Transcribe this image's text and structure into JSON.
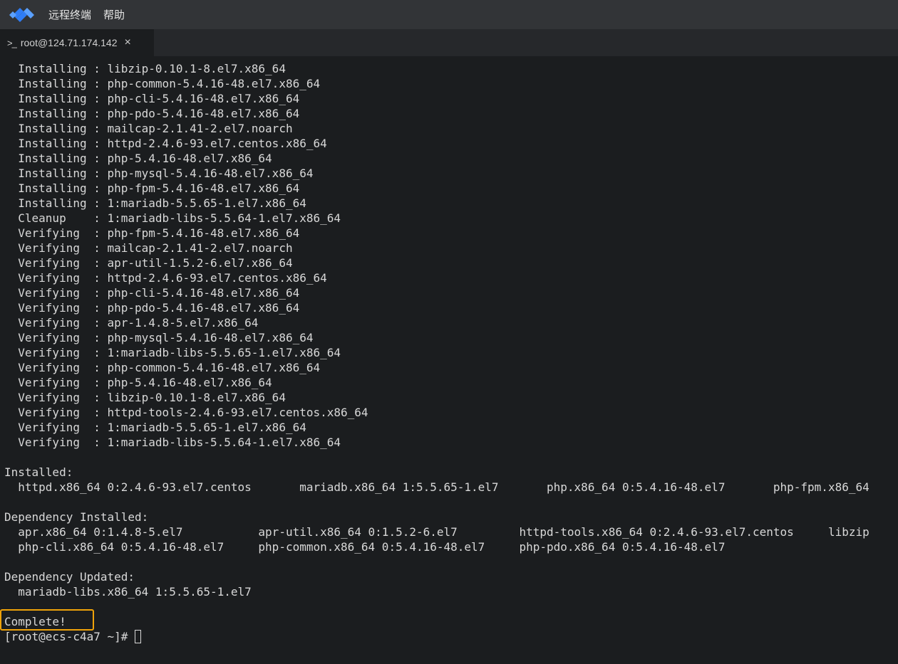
{
  "app": {
    "menu": [
      "远程终端",
      "帮助"
    ],
    "brand_color": "#2f7df6"
  },
  "tab": {
    "icon": "terminal-prompt-icon",
    "prompt_glyph": ">_",
    "label": "root@124.71.174.142",
    "close_glyph": "×"
  },
  "terminal": {
    "lines": [
      "  Installing : libzip-0.10.1-8.el7.x86_64",
      "  Installing : php-common-5.4.16-48.el7.x86_64",
      "  Installing : php-cli-5.4.16-48.el7.x86_64",
      "  Installing : php-pdo-5.4.16-48.el7.x86_64",
      "  Installing : mailcap-2.1.41-2.el7.noarch",
      "  Installing : httpd-2.4.6-93.el7.centos.x86_64",
      "  Installing : php-5.4.16-48.el7.x86_64",
      "  Installing : php-mysql-5.4.16-48.el7.x86_64",
      "  Installing : php-fpm-5.4.16-48.el7.x86_64",
      "  Installing : 1:mariadb-5.5.65-1.el7.x86_64",
      "  Cleanup    : 1:mariadb-libs-5.5.64-1.el7.x86_64",
      "  Verifying  : php-fpm-5.4.16-48.el7.x86_64",
      "  Verifying  : mailcap-2.1.41-2.el7.noarch",
      "  Verifying  : apr-util-1.5.2-6.el7.x86_64",
      "  Verifying  : httpd-2.4.6-93.el7.centos.x86_64",
      "  Verifying  : php-cli-5.4.16-48.el7.x86_64",
      "  Verifying  : php-pdo-5.4.16-48.el7.x86_64",
      "  Verifying  : apr-1.4.8-5.el7.x86_64",
      "  Verifying  : php-mysql-5.4.16-48.el7.x86_64",
      "  Verifying  : 1:mariadb-libs-5.5.65-1.el7.x86_64",
      "  Verifying  : php-common-5.4.16-48.el7.x86_64",
      "  Verifying  : php-5.4.16-48.el7.x86_64",
      "  Verifying  : libzip-0.10.1-8.el7.x86_64",
      "  Verifying  : httpd-tools-2.4.6-93.el7.centos.x86_64",
      "  Verifying  : 1:mariadb-5.5.65-1.el7.x86_64",
      "  Verifying  : 1:mariadb-libs-5.5.64-1.el7.x86_64",
      "",
      "Installed:",
      "  httpd.x86_64 0:2.4.6-93.el7.centos       mariadb.x86_64 1:5.5.65-1.el7       php.x86_64 0:5.4.16-48.el7       php-fpm.x86_64",
      "",
      "Dependency Installed:",
      "  apr.x86_64 0:1.4.8-5.el7           apr-util.x86_64 0:1.5.2-6.el7         httpd-tools.x86_64 0:2.4.6-93.el7.centos     libzip",
      "  php-cli.x86_64 0:5.4.16-48.el7     php-common.x86_64 0:5.4.16-48.el7     php-pdo.x86_64 0:5.4.16-48.el7",
      "",
      "Dependency Updated:",
      "  mariadb-libs.x86_64 1:5.5.65-1.el7",
      "",
      "Complete!"
    ],
    "prompt": "[root@ecs-c4a7 ~]# ",
    "highlight_color": "#f0a30a"
  }
}
